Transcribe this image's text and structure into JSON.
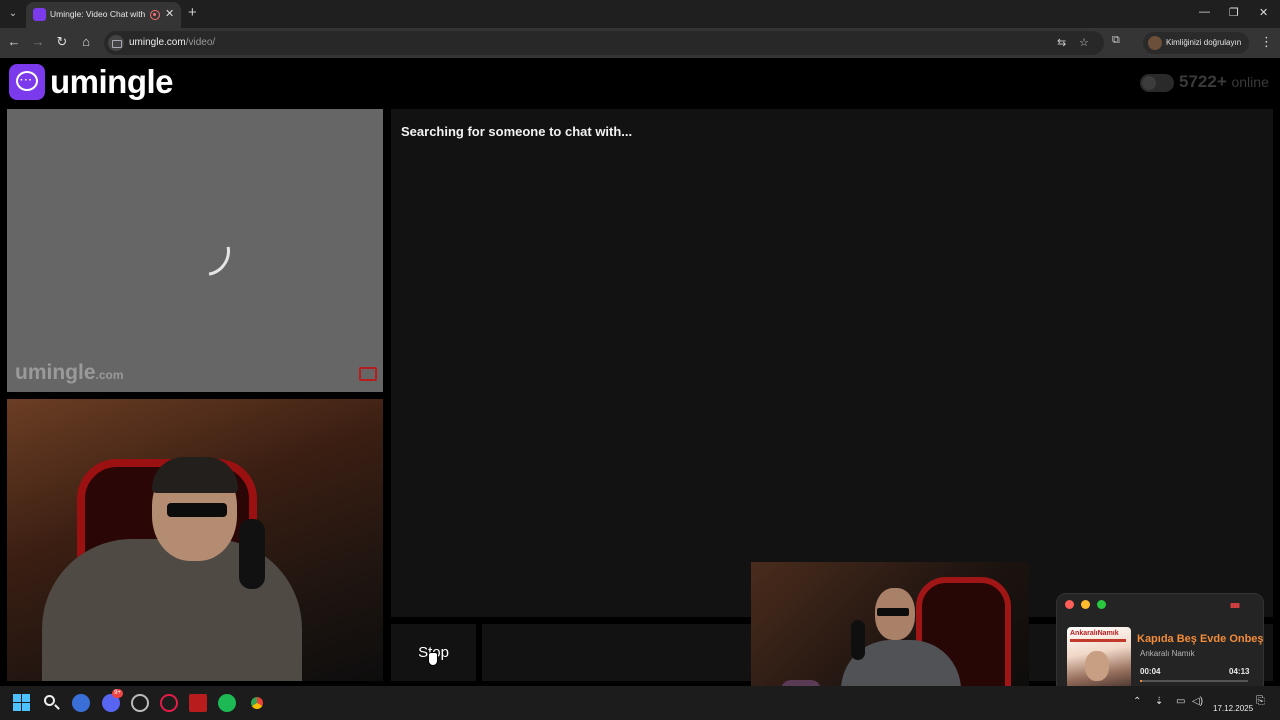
{
  "browser": {
    "tab_title": "Umingle: Video Chat with Strangers",
    "close_glyph": "✕",
    "new_tab_glyph": "+",
    "url_host": "umingle.com",
    "url_path": "/video/",
    "profile_label": "Kimliğinizi doğrulayın",
    "window_controls": [
      "—",
      "❐",
      "✕"
    ],
    "nav_glyphs": {
      "back": "←",
      "forward": "→",
      "reload": "↻",
      "home": "⌂",
      "menu": "⌄",
      "more": "⋮"
    }
  },
  "site": {
    "brand": "umingle",
    "brand_color": "#7c3aed",
    "online_count": "5722+",
    "online_label": "online"
  },
  "stranger": {
    "watermark": "umingle",
    "watermark_suffix": ".com",
    "report_icon": "flag-icon"
  },
  "chat": {
    "status": "Searching for someone to chat with...",
    "stop_label": "Stop"
  },
  "music_player": {
    "track": "Kapıda Beş Evde Onbeş",
    "artist": "Ankaralı Namık",
    "cover_text": "AnkaralıNamık",
    "time_current": "00:04",
    "time_total": "04:13",
    "progress": 0.016,
    "accent": "#f28c3a"
  },
  "taskbar": {
    "discord_badge": "9+",
    "date": "17.12.2025",
    "icons": [
      "windows-start-icon",
      "search-icon",
      "app-icon",
      "discord-icon",
      "app-icon",
      "opera-gx-icon",
      "app-icon",
      "spotify-icon",
      "chrome-icon"
    ]
  }
}
